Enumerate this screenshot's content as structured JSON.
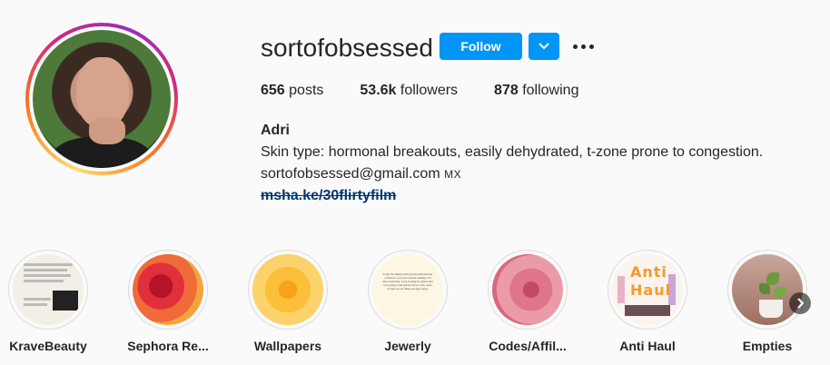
{
  "profile": {
    "username": "sortofobsessed",
    "follow_label": "Follow",
    "stats": {
      "posts_count": "656",
      "posts_label": "posts",
      "followers_count": "53.6k",
      "followers_label": "followers",
      "following_count": "878",
      "following_label": "following"
    },
    "bio": {
      "name": "Adri",
      "line1": "Skin type: hormonal breakouts, easily dehydrated, t-zone prone to congestion.",
      "email": "sortofobsessed@gmail.com",
      "location": "MX",
      "link": "msha.ke/30flirtyfilm"
    }
  },
  "highlights": [
    {
      "label": "KraveBeauty",
      "icon": "text-screenshot-thumbnail"
    },
    {
      "label": "Sephora Re...",
      "icon": "red-rose-thumbnail"
    },
    {
      "label": "Wallpapers",
      "icon": "yellow-flower-thumbnail"
    },
    {
      "label": "Jewerly",
      "icon": "note-card-thumbnail"
    },
    {
      "label": "Codes/Affil...",
      "icon": "pink-rose-thumbnail"
    },
    {
      "label": "Anti Haul",
      "icon": "anti-haul-thumbnail"
    },
    {
      "label": "Empties",
      "icon": "plant-pot-thumbnail"
    }
  ],
  "highlight_text": {
    "jewerly_card": "Today I'm sharing with you my small jewelry collection. Last year I started wanting a bit more in jewelry. I was looking for objects that were going to last and not throw a few rocks. So here we are. Hope you guys enjoy.",
    "anti_haul_word1": "Anti",
    "anti_haul_word2": "Haul"
  },
  "colors": {
    "accent": "#0095f6",
    "link": "#00376b",
    "text": "#262626",
    "background": "#fafafa"
  }
}
